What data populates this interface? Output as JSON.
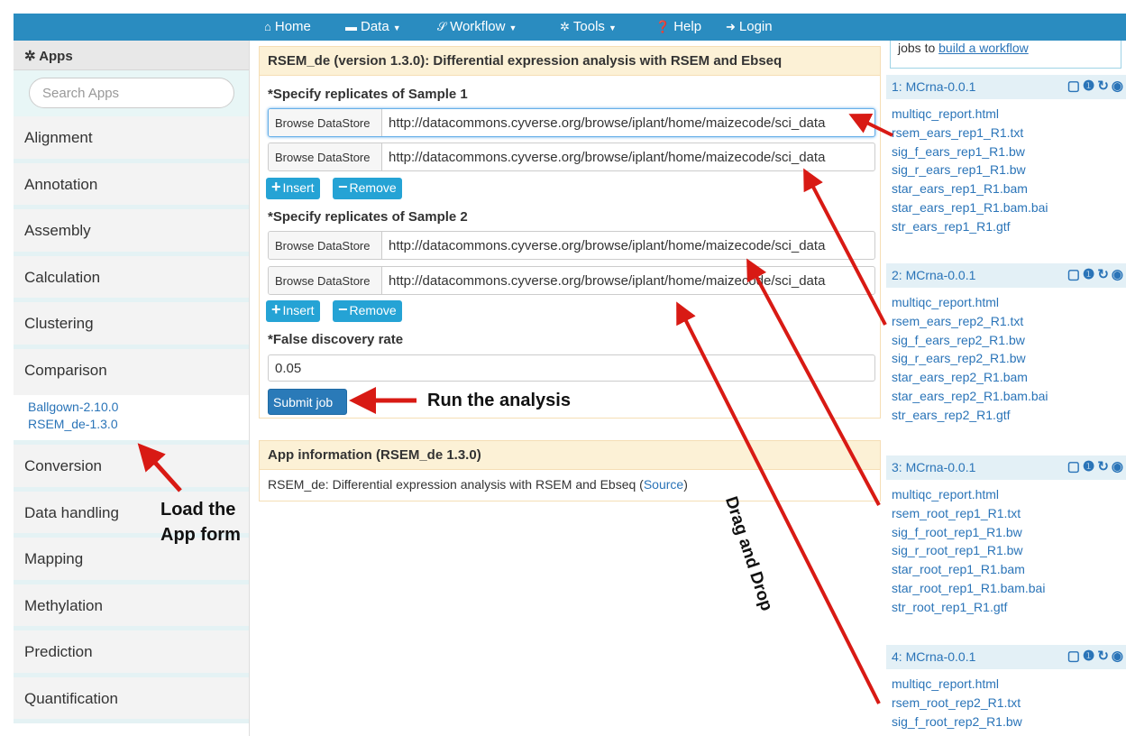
{
  "navbar": {
    "items": [
      {
        "icon": "home-icon",
        "glyph": "⌂",
        "label": "Home",
        "caret": false
      },
      {
        "icon": "laptop-icon",
        "glyph": "▬",
        "label": "Data",
        "caret": true
      },
      {
        "icon": "workflow-icon",
        "glyph": "𝒮",
        "label": "Workflow",
        "caret": true
      },
      {
        "icon": "gear-icon",
        "glyph": "✲",
        "label": "Tools",
        "caret": true
      },
      {
        "icon": "help-icon",
        "glyph": "❓",
        "label": "Help",
        "caret": false
      },
      {
        "icon": "login-icon",
        "glyph": "➜",
        "label": "Login",
        "caret": false
      }
    ]
  },
  "sidebar": {
    "header": "Apps",
    "search_placeholder": "Search Apps",
    "categories_top": [
      "Alignment",
      "Annotation",
      "Assembly",
      "Calculation",
      "Clustering",
      "Comparison"
    ],
    "comparison_apps": [
      "Ballgown-2.10.0",
      "RSEM_de-1.3.0"
    ],
    "categories_bottom": [
      "Conversion",
      "Data handling",
      "Mapping",
      "Methylation",
      "Prediction",
      "Quantification"
    ]
  },
  "app_form": {
    "title": "RSEM_de (version 1.3.0): Differential expression analysis with RSEM and Ebseq",
    "sample1_label": "*Specify replicates of Sample 1",
    "sample2_label": "*Specify replicates of Sample 2",
    "browse_label": "Browse DataStore",
    "sample1_urls": [
      "http://datacommons.cyverse.org/browse/iplant/home/maizecode/sci_data",
      "http://datacommons.cyverse.org/browse/iplant/home/maizecode/sci_data"
    ],
    "sample2_urls": [
      "http://datacommons.cyverse.org/browse/iplant/home/maizecode/sci_data",
      "http://datacommons.cyverse.org/browse/iplant/home/maizecode/sci_data"
    ],
    "insert_label": "Insert",
    "remove_label": "Remove",
    "fdr_label": "*False discovery rate",
    "fdr_value": "0.05",
    "submit_label": "Submit job"
  },
  "app_info": {
    "title": "App information (RSEM_de 1.3.0)",
    "description": "RSEM_de: Differential expression analysis with RSEM and Ebseq (",
    "source_link": "Source",
    "close_paren": ")"
  },
  "right_panel": {
    "hint_prefix": "jobs to ",
    "hint_link": "build a workflow",
    "jobs": [
      {
        "title": "1: MCrna-0.0.1",
        "files": [
          "multiqc_report.html",
          "rsem_ears_rep1_R1.txt",
          "sig_f_ears_rep1_R1.bw",
          "sig_r_ears_rep1_R1.bw",
          "star_ears_rep1_R1.bam",
          "star_ears_rep1_R1.bam.bai",
          "str_ears_rep1_R1.gtf"
        ]
      },
      {
        "title": "2: MCrna-0.0.1",
        "files": [
          "multiqc_report.html",
          "rsem_ears_rep2_R1.txt",
          "sig_f_ears_rep2_R1.bw",
          "sig_r_ears_rep2_R1.bw",
          "star_ears_rep2_R1.bam",
          "star_ears_rep2_R1.bam.bai",
          "str_ears_rep2_R1.gtf"
        ]
      },
      {
        "title": "3: MCrna-0.0.1",
        "files": [
          "multiqc_report.html",
          "rsem_root_rep1_R1.txt",
          "sig_f_root_rep1_R1.bw",
          "sig_r_root_rep1_R1.bw",
          "star_root_rep1_R1.bam",
          "star_root_rep1_R1.bam.bai",
          "str_root_rep1_R1.gtf"
        ]
      },
      {
        "title": "4: MCrna-0.0.1",
        "files": [
          "multiqc_report.html",
          "rsem_root_rep2_R1.txt",
          "sig_f_root_rep2_R1.bw"
        ]
      }
    ],
    "job_icon_glyphs": "▢❶↻◉"
  },
  "annotations": {
    "run_analysis": "Run the analysis",
    "load_form_line1": "Load the",
    "load_form_line2": "App form",
    "drag_drop": "Drag and Drop",
    "arrow_color": "#d81a14"
  }
}
